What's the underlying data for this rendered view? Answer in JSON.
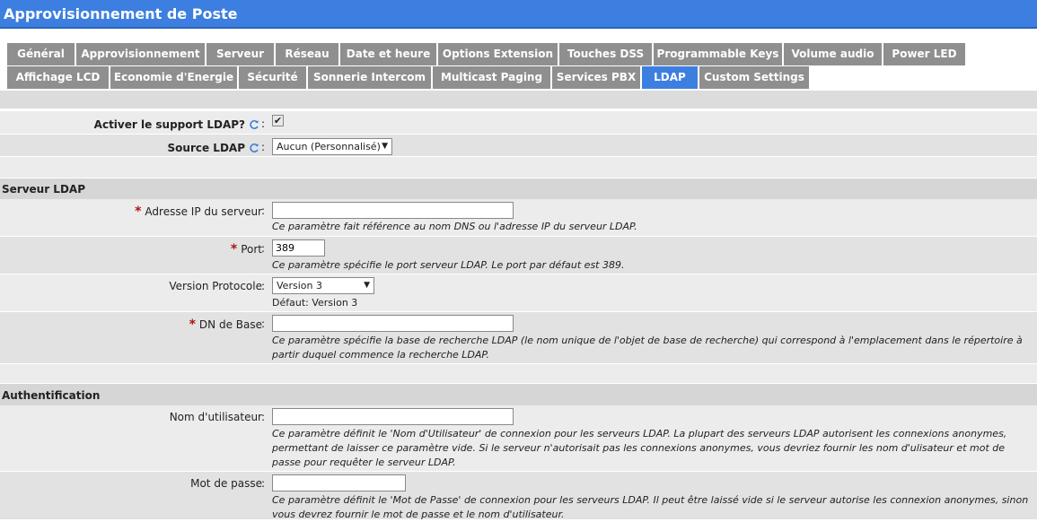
{
  "title": "Approvisionnement de Poste",
  "tabs_row1": [
    "Général",
    "Approvisionnement",
    "Serveur",
    "Réseau",
    "Date et heure",
    "Options Extension",
    "Touches DSS",
    "Programmable Keys",
    "Volume audio",
    "Power LED"
  ],
  "tabs_row2": [
    "Affichage LCD",
    "Economie d'Energie",
    "Sécurité",
    "Sonnerie Intercom",
    "Multicast Paging",
    "Services PBX",
    "LDAP",
    "Custom Settings"
  ],
  "active_tab": "LDAP",
  "top": {
    "enable_label": "Activer le support LDAP?",
    "enable_checked": true,
    "source_label": "Source LDAP",
    "source_value": "Aucun (Personnalisé)"
  },
  "server_section": {
    "title": "Serveur LDAP",
    "ip_label": "Adresse IP du serveur",
    "ip_value": "",
    "ip_help": "Ce paramètre fait référence au nom DNS ou l'adresse IP du serveur LDAP.",
    "port_label": "Port",
    "port_value": "389",
    "port_help": "Ce paramètre spécifie le port serveur LDAP. Le port par défaut est 389.",
    "version_label": "Version Protocole",
    "version_value": "Version 3",
    "version_default": "Défaut: Version 3",
    "dn_label": "DN de Base",
    "dn_value": "",
    "dn_help": "Ce paramètre spécifie la base de recherche LDAP (le nom unique de l'objet de base de recherche) qui correspond à l'emplacement dans le répertoire à partir duquel commence la recherche LDAP."
  },
  "auth_section": {
    "title": "Authentification",
    "user_label": "Nom d'utilisateur",
    "user_value": "",
    "user_help": "Ce paramètre définit le 'Nom d'Utilisateur' de connexion pour les serveurs LDAP. La plupart des serveurs LDAP autorisent les connexions anonymes, permettant de laisser ce paramètre vide. Si le serveur n'autorisait pas les connexions anonymes, vous devriez fournir les nom d'ulisateur et mot de passe pour requêter le serveur LDAP.",
    "pass_label": "Mot de passe",
    "pass_value": "",
    "pass_help": "Ce paramètre définit le 'Mot de Passe' de connexion pour les serveurs LDAP. Il peut être laissé vide si le serveur autorise les connexion anonymes, sinon vous devrez fournir le mot de passe et le nom d'utilisateur."
  },
  "colors": {
    "accent": "#3d7fe0",
    "tab_inactive": "#8f8f8f",
    "required": "#b01010"
  }
}
